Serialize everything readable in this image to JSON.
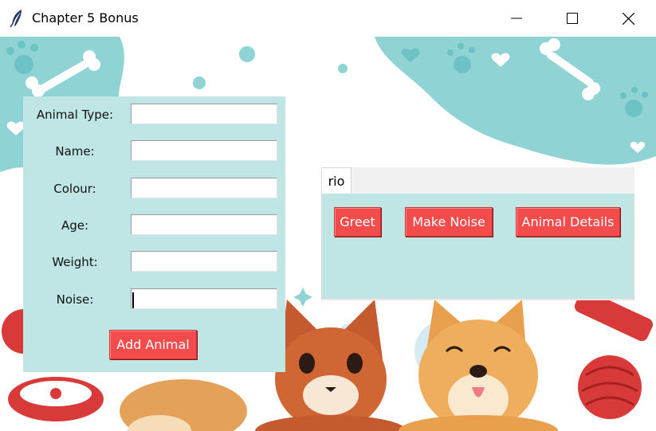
{
  "window": {
    "title": "Chapter 5 Bonus",
    "icon": "feather-icon",
    "controls": [
      "minimize-icon",
      "maximize-icon",
      "close-icon"
    ]
  },
  "form": {
    "fields": [
      {
        "label": "Animal Type:",
        "value": ""
      },
      {
        "label": "Name:",
        "value": ""
      },
      {
        "label": "Colour:",
        "value": ""
      },
      {
        "label": "Age:",
        "value": ""
      },
      {
        "label": "Weight:",
        "value": ""
      },
      {
        "label": "Noise:",
        "value": ""
      }
    ],
    "add_button": "Add Animal"
  },
  "notebook": {
    "tabs": [
      {
        "label": "rio"
      }
    ],
    "buttons": {
      "greet": "Greet",
      "make_noise": "Make Noise",
      "details": "Animal Details"
    }
  },
  "colors": {
    "panel_bg": "#bfe6e4",
    "button_bg": "#f44c4c",
    "button_text": "#ffffff",
    "decor_teal": "#8fd3d4"
  }
}
